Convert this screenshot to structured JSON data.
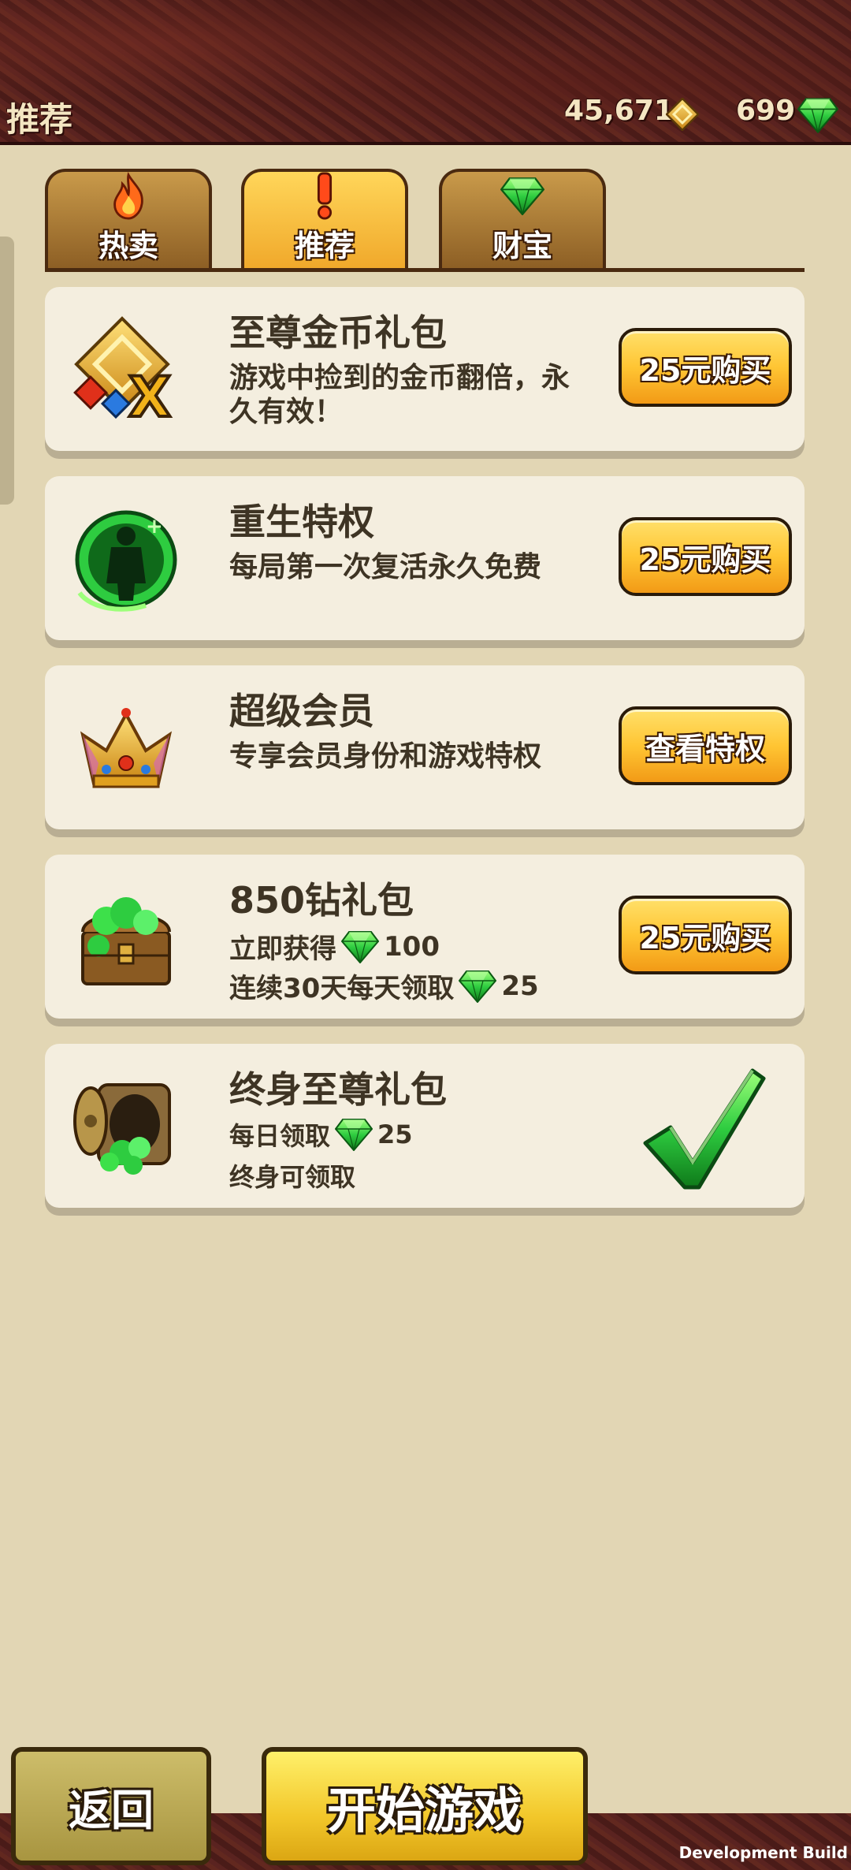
{
  "header": {
    "title": "推荐",
    "coins": "45,671",
    "gems": "699"
  },
  "tabs": [
    {
      "label": "热卖",
      "icon": "fire-icon",
      "active": false
    },
    {
      "label": "推荐",
      "icon": "exclamation-icon",
      "active": true
    },
    {
      "label": "财宝",
      "icon": "gem-icon",
      "active": false
    }
  ],
  "cards": [
    {
      "title": "至尊金币礼包",
      "desc": "游戏中捡到的金币翻倍，永久有效！",
      "button": "25元购买",
      "icon": "coin-multiplier-icon"
    },
    {
      "title": "重生特权",
      "desc": "每局第一次复活永久免费",
      "button": "25元购买",
      "icon": "revive-icon"
    },
    {
      "title": "超级会员",
      "desc": "专享会员身份和游戏特权",
      "button": "查看特权",
      "icon": "crown-icon"
    },
    {
      "title": "850钻礼包",
      "line1_prefix": "立即获得",
      "line1_value": "100",
      "line2_prefix": "连续30天每天领取",
      "line2_value": "25",
      "button": "25元购买",
      "icon": "treasure-chest-icon"
    },
    {
      "title": "终身至尊礼包",
      "line1_prefix": "每日领取",
      "line1_value": "25",
      "line2": "终身可领取",
      "icon": "vault-icon",
      "status": "check-icon"
    }
  ],
  "footer": {
    "back": "返回",
    "start": "开始游戏",
    "dev_build": "Development Build"
  },
  "colors": {
    "accent": "#ffc533",
    "gem": "#2ecc40",
    "text": "#3e3424",
    "background": "#e2d6b4"
  }
}
